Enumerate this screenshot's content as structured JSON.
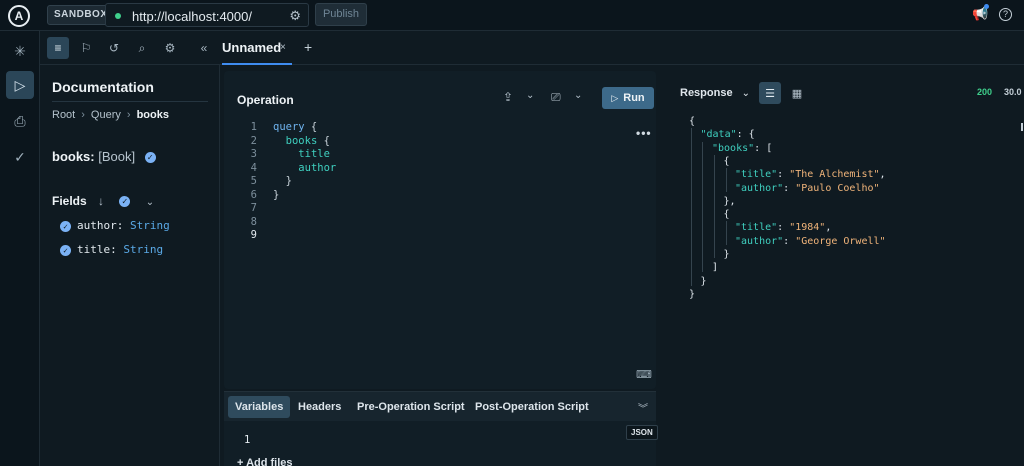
{
  "topbar": {
    "logo_letter": "A",
    "mode_badge": "SANDBOX",
    "endpoint_url": "http://localhost:4000/",
    "publish_label": "Publish",
    "icons": [
      "megaphone-icon",
      "help-icon",
      "gear-icon"
    ]
  },
  "rail": {
    "items": [
      {
        "name": "home-icon",
        "glyph": "✳"
      },
      {
        "name": "explorer-icon",
        "glyph": "▷",
        "active": true
      },
      {
        "name": "schema-icon",
        "glyph": "⎙"
      },
      {
        "name": "checks-icon",
        "glyph": "✓"
      }
    ]
  },
  "subbar": {
    "icons": [
      "documentation-icon",
      "bookmark-icon",
      "history-icon",
      "search-icon",
      "settings-icon",
      "collapse-icon"
    ],
    "tab_label": "Unnamed",
    "tab_close": "×",
    "tab_add": "+"
  },
  "docs": {
    "title": "Documentation",
    "breadcrumb": [
      "Root",
      "Query",
      "books"
    ],
    "type_field": "books:",
    "type_name": "[Book]",
    "fields_label": "Fields",
    "fields": [
      {
        "name": "author:",
        "type": "String"
      },
      {
        "name": "title:",
        "type": "String"
      }
    ]
  },
  "operation": {
    "title": "Operation",
    "run_label": "Run",
    "more_label": "•••",
    "lines": [
      {
        "n": "1",
        "indent": "",
        "parts": [
          {
            "t": "kw",
            "v": "query"
          },
          {
            "t": "pun",
            "v": " {"
          }
        ]
      },
      {
        "n": "2",
        "indent": "  ",
        "parts": [
          {
            "t": "fld",
            "v": "books"
          },
          {
            "t": "pun",
            "v": " {"
          }
        ]
      },
      {
        "n": "3",
        "indent": "    ",
        "parts": [
          {
            "t": "fld",
            "v": "title"
          }
        ]
      },
      {
        "n": "4",
        "indent": "    ",
        "parts": [
          {
            "t": "fld",
            "v": "author"
          }
        ]
      },
      {
        "n": "5",
        "indent": "  ",
        "parts": [
          {
            "t": "pun",
            "v": "}"
          }
        ]
      },
      {
        "n": "6",
        "indent": "",
        "parts": [
          {
            "t": "pun",
            "v": "}"
          }
        ]
      },
      {
        "n": "7",
        "indent": "",
        "parts": []
      },
      {
        "n": "8",
        "indent": "",
        "parts": []
      },
      {
        "n": "9",
        "indent": "",
        "parts": [],
        "current": true
      }
    ]
  },
  "variables": {
    "tabs": [
      "Variables",
      "Headers",
      "Pre-Operation Script",
      "Post-Operation Script"
    ],
    "active_tab": "Variables",
    "format_badge": "JSON",
    "line1": "1",
    "add_files": "+ Add files"
  },
  "response": {
    "title": "Response",
    "status": "200",
    "time": "30.0",
    "lines": [
      {
        "i": 0,
        "parts": [
          {
            "t": "p",
            "v": "{"
          }
        ]
      },
      {
        "i": 1,
        "parts": [
          {
            "t": "k",
            "v": "\"data\""
          },
          {
            "t": "p",
            "v": ": {"
          }
        ]
      },
      {
        "i": 2,
        "parts": [
          {
            "t": "k",
            "v": "\"books\""
          },
          {
            "t": "p",
            "v": ": ["
          }
        ]
      },
      {
        "i": 3,
        "parts": [
          {
            "t": "p",
            "v": "{"
          }
        ]
      },
      {
        "i": 4,
        "parts": [
          {
            "t": "k",
            "v": "\"title\""
          },
          {
            "t": "p",
            "v": ": "
          },
          {
            "t": "s",
            "v": "\"The Alchemist\""
          },
          {
            "t": "p",
            "v": ","
          }
        ]
      },
      {
        "i": 4,
        "parts": [
          {
            "t": "k",
            "v": "\"author\""
          },
          {
            "t": "p",
            "v": ": "
          },
          {
            "t": "s",
            "v": "\"Paulo Coelho\""
          }
        ]
      },
      {
        "i": 3,
        "parts": [
          {
            "t": "p",
            "v": "},"
          }
        ]
      },
      {
        "i": 3,
        "parts": [
          {
            "t": "p",
            "v": "{"
          }
        ]
      },
      {
        "i": 4,
        "parts": [
          {
            "t": "k",
            "v": "\"title\""
          },
          {
            "t": "p",
            "v": ": "
          },
          {
            "t": "s",
            "v": "\"1984\""
          },
          {
            "t": "p",
            "v": ","
          }
        ]
      },
      {
        "i": 4,
        "parts": [
          {
            "t": "k",
            "v": "\"author\""
          },
          {
            "t": "p",
            "v": ": "
          },
          {
            "t": "s",
            "v": "\"George Orwell\""
          }
        ]
      },
      {
        "i": 3,
        "parts": [
          {
            "t": "p",
            "v": "}"
          }
        ]
      },
      {
        "i": 2,
        "parts": [
          {
            "t": "p",
            "v": "]"
          }
        ]
      },
      {
        "i": 1,
        "parts": [
          {
            "t": "p",
            "v": "}"
          }
        ]
      },
      {
        "i": 0,
        "parts": [
          {
            "t": "p",
            "v": "}"
          }
        ]
      }
    ]
  }
}
